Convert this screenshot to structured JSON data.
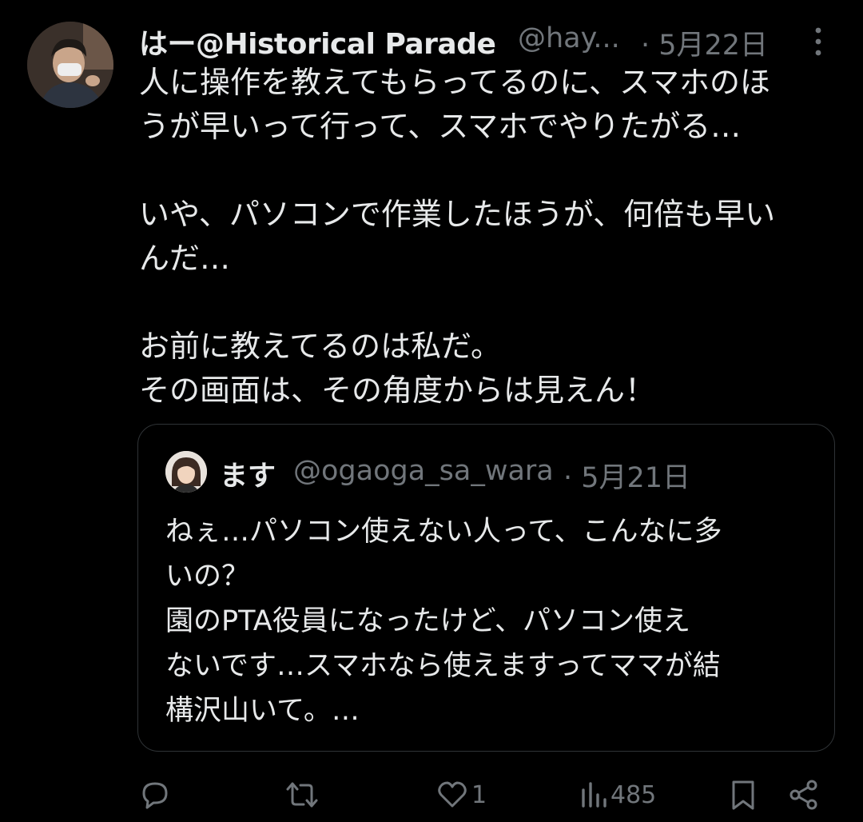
{
  "post": {
    "author_name": "はー@Historical Parade",
    "author_handle": "@hay...",
    "date": "· 5月22日",
    "text_lines": [
      "人に操作を教えてもらってるのに、スマホのほ",
      "うが早いって行って、スマホでやりたがる…",
      "",
      "いや、パソコンで作業したほうが、何倍も早い",
      "んだ…",
      "",
      "お前に教えてるのは私だ。",
      "その画面は、その角度からは見えん！"
    ]
  },
  "quote": {
    "author_name": "ます",
    "author_handle": "@ogaoga_sa_wara",
    "date": "· 5月21日",
    "text_lines": [
      "ねぇ…パソコン使えない人って、こんなに多",
      "いの？",
      "園のPTA役員になったけど、パソコン使え",
      "ないです…スマホなら使えますってママが結",
      "構沢山いて。…"
    ]
  },
  "actions": {
    "reply_count": "",
    "repost_count": "",
    "like_count": "1",
    "views_count": "485"
  },
  "colors": {
    "background": "#000000",
    "text_primary": "#e7e9ea",
    "text_secondary": "#71767b",
    "border": "#2f3336"
  },
  "icons": [
    "more-icon",
    "reply-icon",
    "repost-icon",
    "like-icon",
    "views-icon",
    "bookmark-icon",
    "share-icon"
  ]
}
